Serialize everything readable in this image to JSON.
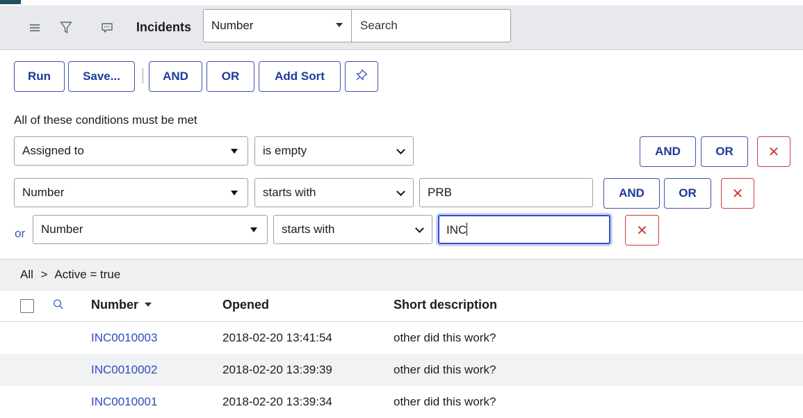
{
  "header": {
    "title": "Incidents",
    "field_select": "Number",
    "search_placeholder": "Search",
    "icons": [
      "hamburger-menu-icon",
      "filter-icon",
      "comment-icon"
    ]
  },
  "actions": {
    "run": "Run",
    "save": "Save...",
    "and": "AND",
    "or": "OR",
    "add_sort": "Add Sort",
    "pin_icon": "pin-icon"
  },
  "conditions": {
    "heading": "All of these conditions must be met",
    "or_label": "or",
    "and_btn": "AND",
    "or_btn": "OR",
    "delete_symbol": "✕",
    "rows": [
      {
        "field": "Assigned to",
        "operator": "is empty",
        "value": ""
      },
      {
        "field": "Number",
        "operator": "starts with",
        "value": "PRB"
      },
      {
        "field": "Number",
        "operator": "starts with",
        "value": "INC"
      }
    ]
  },
  "breadcrumb": {
    "root": "All",
    "separator": ">",
    "filter": "Active = true"
  },
  "table": {
    "columns": [
      "Number",
      "Opened",
      "Short description"
    ],
    "rows": [
      {
        "number": "INC0010003",
        "opened": "2018-02-20 13:41:54",
        "short_description": "other did this work?"
      },
      {
        "number": "INC0010002",
        "opened": "2018-02-20 13:39:39",
        "short_description": "other did this work?"
      },
      {
        "number": "INC0010001",
        "opened": "2018-02-20 13:39:34",
        "short_description": "other did this work?"
      }
    ]
  },
  "colors": {
    "accent_blue": "#3d52b6",
    "link_blue": "#2d4bc0",
    "delete_red": "#cc3b3b",
    "toolbar_bg": "#e7e9ec"
  }
}
